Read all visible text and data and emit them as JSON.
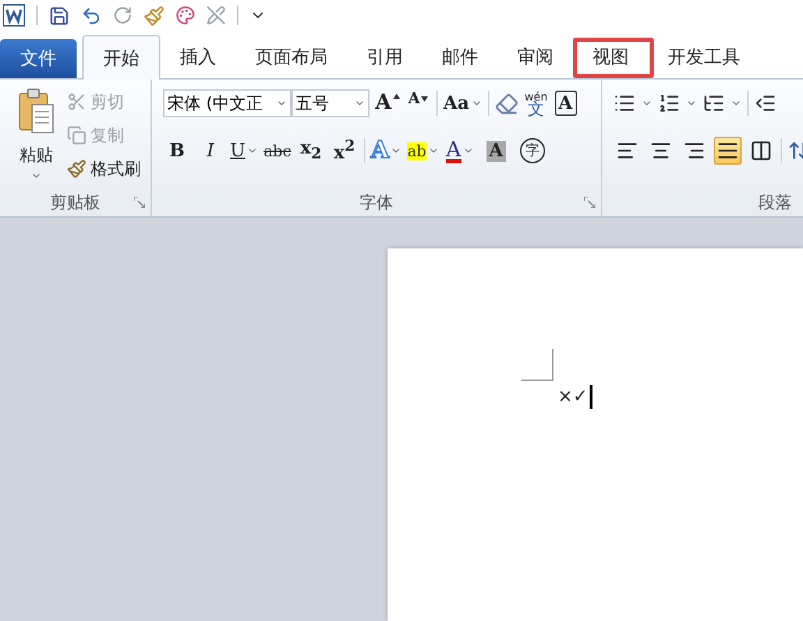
{
  "tabs": [
    {
      "label": "文件",
      "kind": "file",
      "selected": false
    },
    {
      "label": "开始",
      "kind": "tab",
      "selected": true,
      "annotated": false
    },
    {
      "label": "插入",
      "kind": "tab",
      "selected": false,
      "annotated": false
    },
    {
      "label": "页面布局",
      "kind": "tab",
      "selected": false,
      "annotated": false
    },
    {
      "label": "引用",
      "kind": "tab",
      "selected": false,
      "annotated": false
    },
    {
      "label": "邮件",
      "kind": "tab",
      "selected": false,
      "annotated": false
    },
    {
      "label": "审阅",
      "kind": "tab",
      "selected": false,
      "annotated": false
    },
    {
      "label": "视图",
      "kind": "tab",
      "selected": false,
      "annotated": true
    },
    {
      "label": "开发工具",
      "kind": "tab",
      "selected": false,
      "annotated": false
    }
  ],
  "clipboard": {
    "paste": "粘贴",
    "label": "剪贴板",
    "items": [
      {
        "label": "剪切",
        "kind": "cut",
        "disabled": true
      },
      {
        "label": "复制",
        "kind": "copy",
        "disabled": true
      },
      {
        "label": "格式刷",
        "kind": "painter",
        "disabled": false
      }
    ]
  },
  "font": {
    "label": "字体",
    "font_name": "宋体 (中文正",
    "font_size": "五号",
    "grow": "A",
    "shrink": "A",
    "case": "Aa",
    "phonetic_top": "wén",
    "phonetic_main": "文",
    "border_char": "A",
    "formats": [
      {
        "label": "B",
        "kind": "bold",
        "dropdown": false
      },
      {
        "label": "I",
        "kind": "italic",
        "dropdown": false
      },
      {
        "label": "U",
        "kind": "underline",
        "dropdown": true
      },
      {
        "label": "abc",
        "kind": "strike",
        "dropdown": false
      },
      {
        "label": "x$_{2}$",
        "kind": "plain",
        "dropdown": false
      },
      {
        "label": "x$^{2}$",
        "kind": "plain",
        "dropdown": false
      }
    ],
    "effects": [
      {
        "label": "A",
        "kind": "effects",
        "dropdown": true
      },
      {
        "label": "ab",
        "kind": "highlight",
        "dropdown": true
      },
      {
        "label": "A",
        "kind": "fontcolor",
        "dropdown": true
      },
      {
        "label": "A",
        "kind": "shading",
        "dropdown": false
      },
      {
        "label": "字",
        "kind": "enclose",
        "dropdown": false
      }
    ]
  },
  "paragraph": {
    "label": "段落",
    "alignments": [
      {
        "kind": "left",
        "selected": false
      },
      {
        "kind": "center",
        "selected": false
      },
      {
        "kind": "right",
        "selected": false
      },
      {
        "kind": "justify",
        "selected": true
      },
      {
        "kind": "distributed",
        "selected": false
      }
    ]
  },
  "document": {
    "text": "×✓"
  }
}
